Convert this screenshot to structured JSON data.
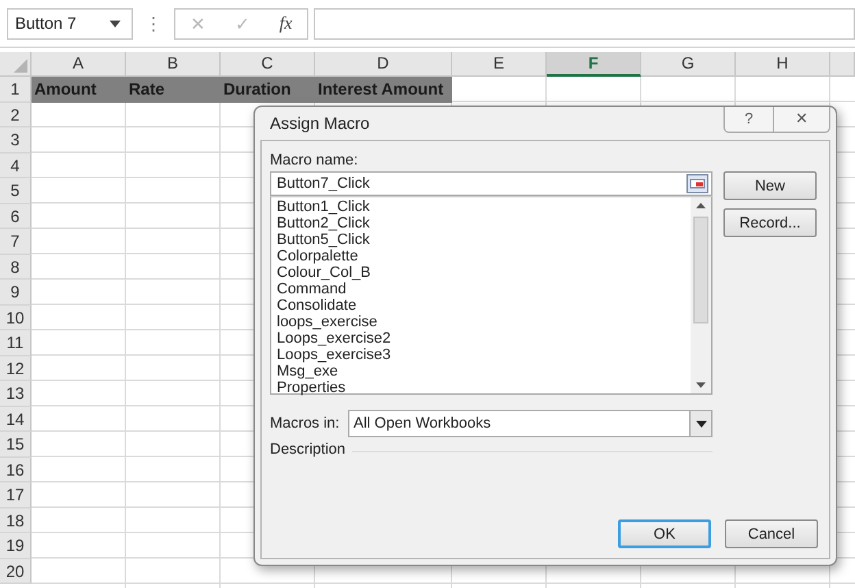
{
  "name_box": {
    "value": "Button 7"
  },
  "formula_bar": {
    "menu_glyph": "⋮",
    "cancel_glyph": "✕",
    "enter_glyph": "✓",
    "function_glyph": "fx"
  },
  "columns": [
    {
      "label": "A",
      "selected": false
    },
    {
      "label": "B",
      "selected": false
    },
    {
      "label": "C",
      "selected": false
    },
    {
      "label": "D",
      "selected": false
    },
    {
      "label": "E",
      "selected": false
    },
    {
      "label": "F",
      "selected": true
    },
    {
      "label": "G",
      "selected": false
    },
    {
      "label": "H",
      "selected": false
    }
  ],
  "rows": [
    "1",
    "2",
    "3",
    "4",
    "5",
    "6",
    "7",
    "8",
    "9",
    "10",
    "11",
    "12",
    "13",
    "14",
    "15",
    "16",
    "17",
    "18",
    "19",
    "20"
  ],
  "header_cells": [
    "Amount",
    "Rate",
    "Duration",
    "Interest Amount"
  ],
  "dialog": {
    "title": "Assign Macro",
    "help_glyph": "?",
    "close_glyph": "✕",
    "macro_name_label": "Macro name:",
    "macro_name": "Button7_Click",
    "macros": [
      {
        "name": "Button1_Click",
        "selected": false
      },
      {
        "name": "Button2_Click",
        "selected": false
      },
      {
        "name": "Button5_Click",
        "selected": false
      },
      {
        "name": "Colorpalette",
        "selected": false
      },
      {
        "name": "Colour_Col_B",
        "selected": false
      },
      {
        "name": "Command",
        "selected": false
      },
      {
        "name": "Consolidate",
        "selected": false
      },
      {
        "name": "loops_exercise",
        "selected": false
      },
      {
        "name": "Loops_exercise2",
        "selected": false
      },
      {
        "name": "Loops_exercise3",
        "selected": false
      },
      {
        "name": "Msg_exe",
        "selected": false
      },
      {
        "name": "Properties",
        "selected": false
      }
    ],
    "macros_in_label": "Macros in:",
    "macros_in": "All Open Workbooks",
    "description_label": "Description",
    "buttons": [
      {
        "label": "New",
        "kind": "side",
        "default": false
      },
      {
        "label": "Record...",
        "kind": "side",
        "default": false
      },
      {
        "label": "OK",
        "kind": "bottom",
        "default": true
      },
      {
        "label": "Cancel",
        "kind": "bottom",
        "default": false
      }
    ]
  }
}
